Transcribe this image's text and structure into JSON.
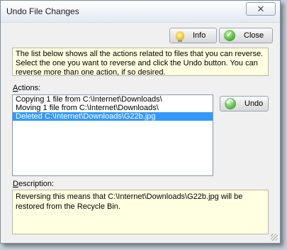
{
  "window": {
    "title": "Undo File Changes",
    "close_glyph": "✕"
  },
  "toolbar": {
    "info_label": "Info",
    "close_label": "Close"
  },
  "info_text": "The list below shows all the actions related to files that you can reverse. Select the one you want to reverse and click the Undo button. You can reverse more than one action, if so desired.",
  "actions": {
    "label_accel": "A",
    "label_rest": "ctions:",
    "items": [
      {
        "text": "Copying 1 file from C:\\Internet\\Downloads\\",
        "selected": false
      },
      {
        "text": "Moving 1 file from C:\\Internet\\Downloads\\",
        "selected": false
      },
      {
        "text": "Deleted C:\\Internet\\Downloads\\G22b.jpg",
        "selected": true
      }
    ],
    "undo_label": "Undo"
  },
  "description": {
    "label_accel": "D",
    "label_rest": "escription:",
    "text": "Reversing this means that C:\\Internet\\Downloads\\G22b.jpg will be restored from the Recycle Bin."
  },
  "colors": {
    "selection": "#3399ff",
    "info_background": "#ffffe1"
  }
}
